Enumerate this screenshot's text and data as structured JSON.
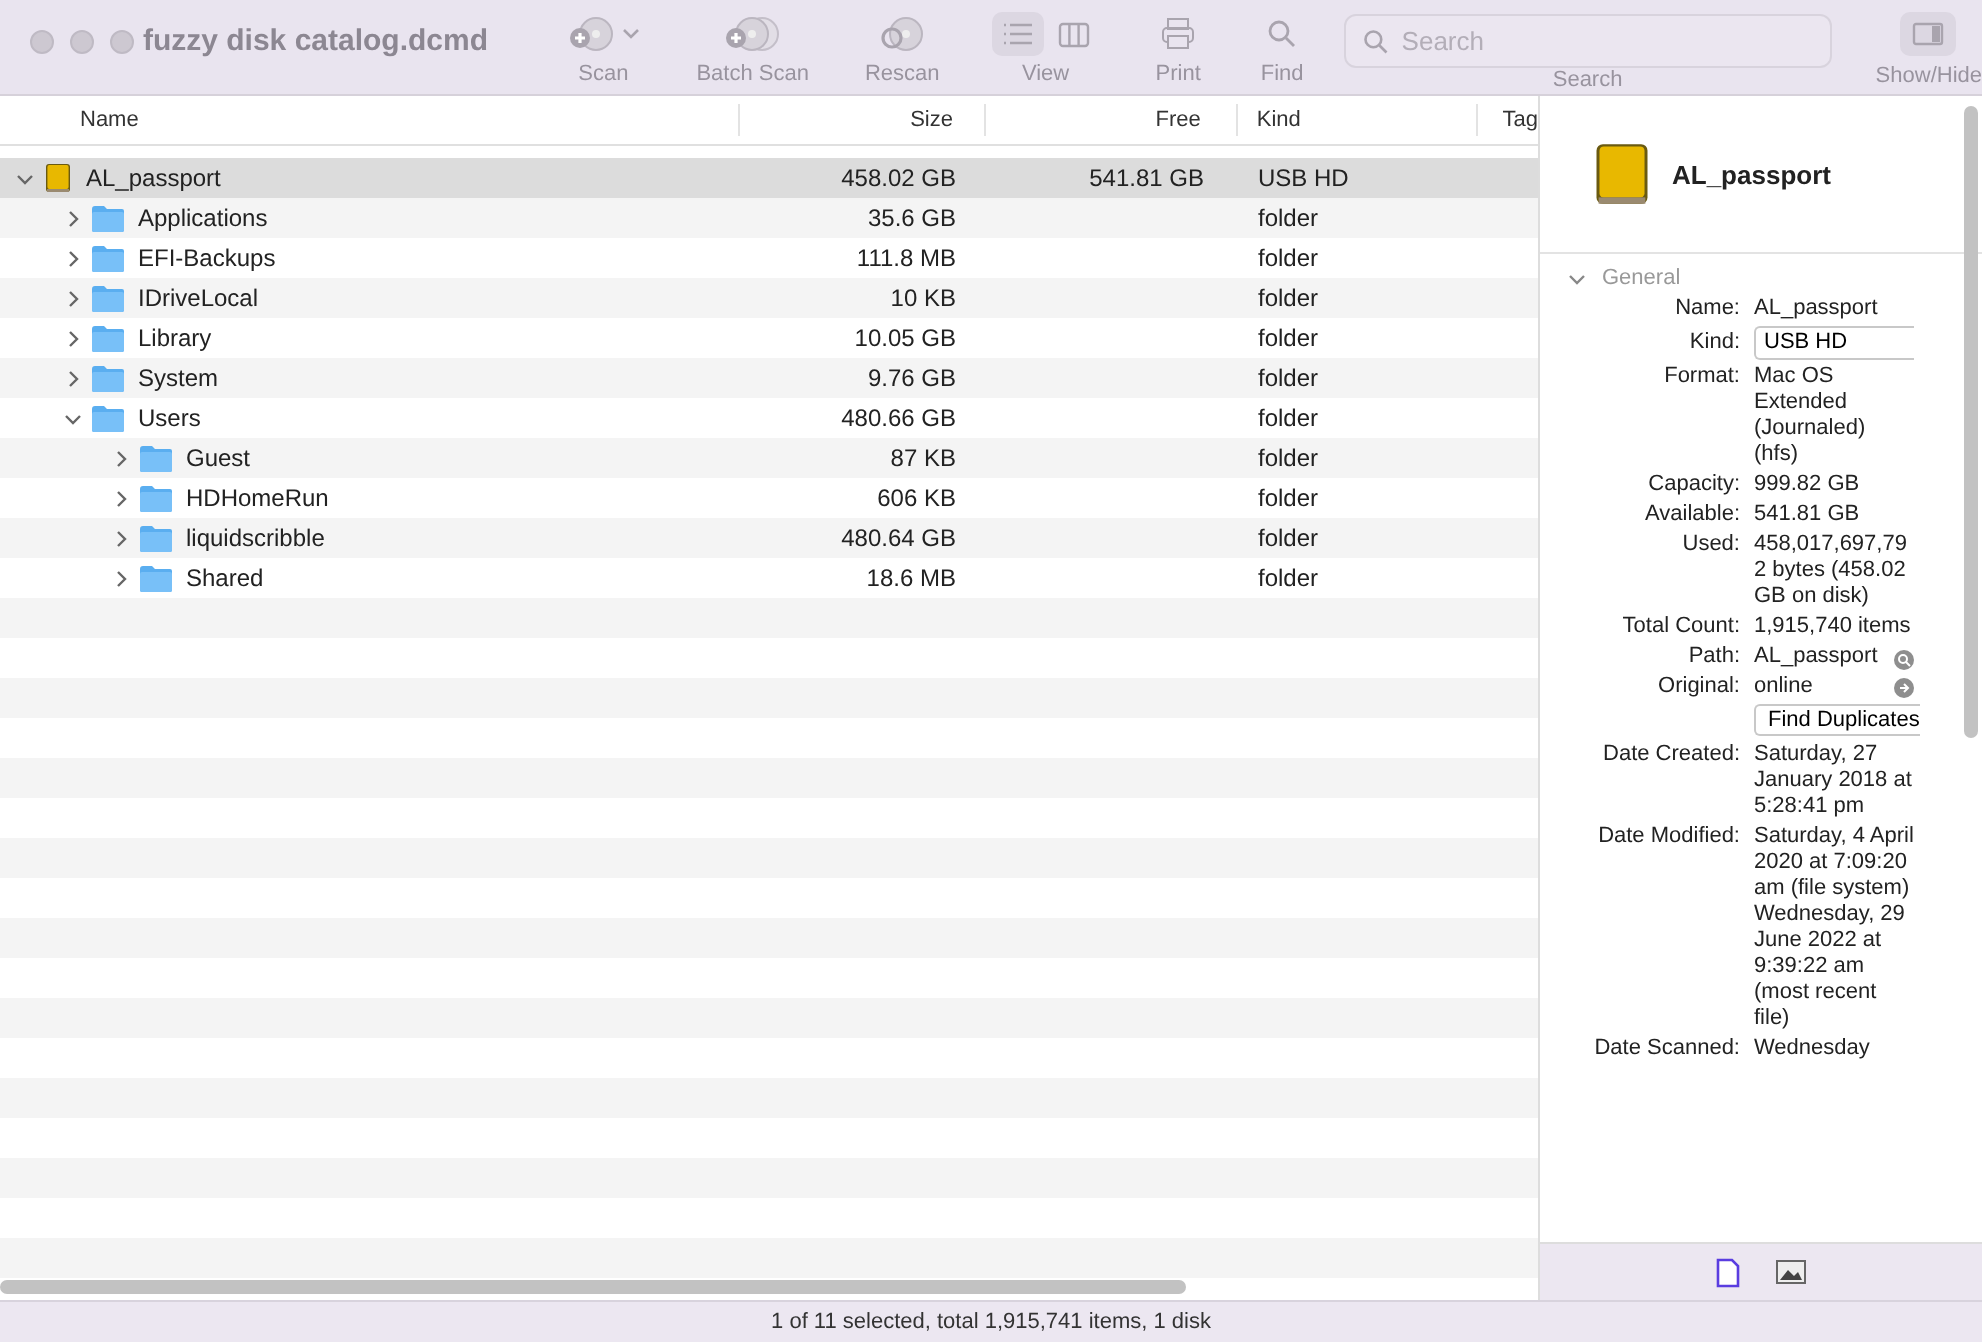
{
  "window": {
    "title": "fuzzy disk catalog.dcmd"
  },
  "toolbar": {
    "items": [
      {
        "kind": "scan",
        "label": "Scan"
      },
      {
        "kind": "batch",
        "label": "Batch Scan"
      },
      {
        "kind": "rescan",
        "label": "Rescan"
      },
      {
        "kind": "view",
        "label": "View"
      },
      {
        "kind": "print",
        "label": "Print"
      },
      {
        "kind": "find",
        "label": "Find"
      },
      {
        "kind": "search",
        "label": "Search",
        "placeholder": "Search"
      },
      {
        "kind": "toggle",
        "label": "Show/Hide"
      }
    ],
    "view_modes": [
      {
        "kind": "list",
        "selected": true
      },
      {
        "kind": "columns",
        "selected": false
      }
    ]
  },
  "table": {
    "columns": [
      "Name",
      "Size",
      "Free",
      "Kind",
      "Tag"
    ],
    "rows": [
      {
        "kind": "drive",
        "name": "AL_passport",
        "size": "458.02 GB",
        "free": "541.81 GB",
        "type": "USB HD",
        "expanded": true,
        "selected": true,
        "children": [
          {
            "kind": "folder",
            "name": "Applications",
            "size": "35.6 GB",
            "type": "folder",
            "expanded": false,
            "selected": false
          },
          {
            "kind": "folder",
            "name": "EFI-Backups",
            "size": "111.8 MB",
            "type": "folder",
            "expanded": false,
            "selected": false
          },
          {
            "kind": "folder",
            "name": "IDriveLocal",
            "size": "10 KB",
            "type": "folder",
            "expanded": false,
            "selected": false
          },
          {
            "kind": "folder",
            "name": "Library",
            "size": "10.05 GB",
            "type": "folder",
            "expanded": false,
            "selected": false
          },
          {
            "kind": "folder",
            "name": "System",
            "size": "9.76 GB",
            "type": "folder",
            "expanded": false,
            "selected": false
          },
          {
            "kind": "folder",
            "name": "Users",
            "size": "480.66 GB",
            "type": "folder",
            "expanded": true,
            "selected": false,
            "children": [
              {
                "kind": "folder",
                "name": "Guest",
                "size": "87 KB",
                "type": "folder",
                "expanded": false,
                "selected": false
              },
              {
                "kind": "folder",
                "name": "HDHomeRun",
                "size": "606 KB",
                "type": "folder",
                "expanded": false,
                "selected": false
              },
              {
                "kind": "folder",
                "name": "liquidscribble",
                "size": "480.64 GB",
                "type": "folder",
                "expanded": false,
                "selected": false
              },
              {
                "kind": "folder",
                "name": "Shared",
                "size": "18.6 MB",
                "type": "folder",
                "expanded": false,
                "selected": false
              }
            ]
          }
        ]
      }
    ]
  },
  "inspector": {
    "title": "AL_passport",
    "section": {
      "title": "General",
      "expanded": true
    },
    "properties": [
      {
        "kind": "text",
        "label": "Name:",
        "value": "AL_passport"
      },
      {
        "kind": "field",
        "label": "Kind:",
        "value": "USB HD"
      },
      {
        "kind": "text",
        "label": "Format:",
        "value": "Mac OS Extended (Journaled) (hfs)"
      },
      {
        "kind": "text",
        "label": "Capacity:",
        "value": "999.82 GB"
      },
      {
        "kind": "text",
        "label": "Available:",
        "value": "541.81 GB"
      },
      {
        "kind": "text",
        "label": "Used:",
        "value": "458,017,697,792 bytes (458.02 GB on disk)"
      },
      {
        "kind": "text",
        "label": "Total Count:",
        "value": "1,915,740 items"
      },
      {
        "kind": "path",
        "label": "Path:",
        "value": "AL_passport"
      },
      {
        "kind": "link",
        "label": "Original:",
        "value": "online"
      },
      {
        "kind": "button",
        "value": "Find Duplicates"
      },
      {
        "kind": "text",
        "label": "Date Created:",
        "value": "Saturday, 27 January 2018 at 5:28:41 pm"
      },
      {
        "kind": "text",
        "label": "Date Modified:",
        "value": "Saturday, 4 April 2020 at 7:09:20 am (file system) Wednesday, 29 June 2022 at 9:39:22 am (most recent file)"
      },
      {
        "kind": "text",
        "label": "Date Scanned:",
        "value": "Wednesday"
      }
    ],
    "tabs": [
      {
        "kind": "info",
        "selected": true
      },
      {
        "kind": "preview",
        "selected": false
      }
    ]
  },
  "status_bar": "1 of 11 selected, total 1,915,741 items, 1 disk"
}
